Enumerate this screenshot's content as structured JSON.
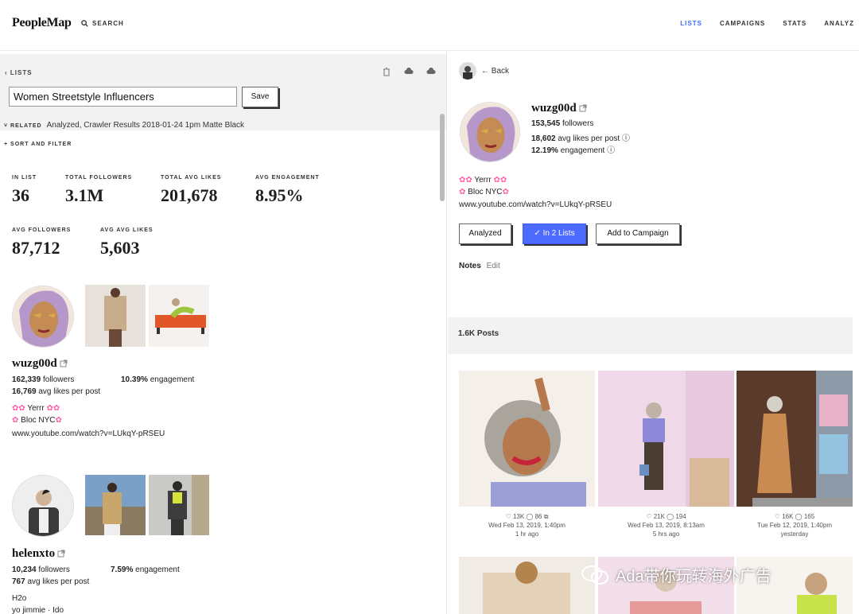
{
  "app": {
    "logo": "PeopleMap",
    "search_label": "SEARCH",
    "nav": [
      "LISTS",
      "CAMPAIGNS",
      "STATS",
      "ANALYZ"
    ]
  },
  "list_panel": {
    "back_label": "LISTS",
    "list_name": "Women Streetstyle Influencers",
    "save_label": "Save",
    "related_label": "RELATED",
    "related_text": "Analyzed, Crawler Results 2018-01-24 1pm Matte Black",
    "sort_filter_label": "+ SORT AND FILTER",
    "stats": [
      {
        "label": "IN LIST",
        "value": "36"
      },
      {
        "label": "TOTAL FOLLOWERS",
        "value": "3.1M"
      },
      {
        "label": "TOTAL AVG LIKES",
        "value": "201,678"
      },
      {
        "label": "AVG ENGAGEMENT",
        "value": "8.95%"
      },
      {
        "label": "AVG FOLLOWERS",
        "value": "87,712"
      },
      {
        "label": "AVG AVG LIKES",
        "value": "5,603"
      }
    ],
    "influencers": [
      {
        "username": "wuzg00d",
        "followers": "162,339",
        "followers_label": "followers",
        "avg_likes": "16,769",
        "avg_likes_label": "avg likes per post",
        "engagement": "10.39%",
        "engagement_label": "engagement",
        "bio1": "Yerrr",
        "bio2": "Bloc NYC",
        "url": "www.youtube.com/watch?v=LUkqY-pRSEU"
      },
      {
        "username": "helenxto",
        "followers": "10,234",
        "followers_label": "followers",
        "avg_likes": "767",
        "avg_likes_label": "avg likes per post",
        "engagement": "7.59%",
        "engagement_label": "engagement",
        "bio1": "H2o",
        "bio2": "yo jimmie · Ido"
      }
    ]
  },
  "detail_panel": {
    "back_label": "← Back",
    "username": "wuzg00d",
    "followers": "153,545",
    "followers_label": "followers",
    "avg_likes": "18,602",
    "avg_likes_label": "avg likes per post",
    "engagement": "12.19%",
    "engagement_label": "engagement",
    "bio1": "Yerrr",
    "bio2": "Bloc NYC",
    "url": "www.youtube.com/watch?v=LUkqY-pRSEU",
    "btn_analyzed": "Analyzed",
    "btn_in_lists": "In 2 Lists",
    "btn_add_campaign": "Add to Campaign",
    "notes_label": "Notes",
    "edit_label": "Edit",
    "posts_count": "1.6K Posts",
    "posts": [
      {
        "likes": "13K",
        "comments": "86",
        "date": "Wed Feb 13, 2019, 1:40pm",
        "ago": "1 hr ago"
      },
      {
        "likes": "21K",
        "comments": "194",
        "date": "Wed Feb 13, 2019, 8:13am",
        "ago": "5 hrs ago"
      },
      {
        "likes": "16K",
        "comments": "165",
        "date": "Tue Feb 12, 2019, 1:40pm",
        "ago": "yesterday"
      }
    ]
  },
  "watermark": "Ada带你玩转海外广告",
  "colors": {
    "accent": "#3d6bff",
    "pink": "#ff5fa8",
    "button_blue": "#4d6bff"
  }
}
